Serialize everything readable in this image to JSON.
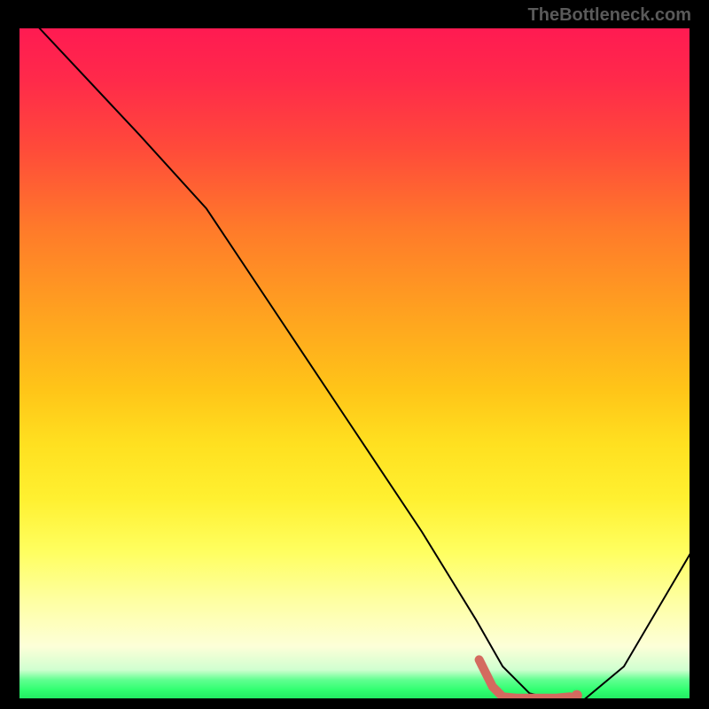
{
  "attribution": "TheBottleneck.com",
  "chart_data": {
    "type": "line",
    "title": "",
    "xlabel": "",
    "ylabel": "",
    "xlim": [
      0,
      100
    ],
    "ylim": [
      0,
      100
    ],
    "series": [
      {
        "name": "bottleneck-curve",
        "x": [
          3,
          18,
          28,
          40,
          50,
          60,
          68,
          72,
          76,
          80,
          84,
          90,
          100
        ],
        "values": [
          100,
          84,
          73,
          55,
          40,
          25,
          12,
          5,
          1,
          0,
          0,
          5,
          22
        ],
        "color": "#000000",
        "width": 2
      }
    ],
    "highlight_band": {
      "name": "optimal-range",
      "x": [
        68.5,
        70.5,
        72,
        74,
        76,
        78,
        80,
        82
      ],
      "values": [
        6,
        2,
        0.5,
        0.3,
        0.3,
        0.3,
        0.3,
        0.5
      ],
      "color": "#d46a5f",
      "width": 10
    },
    "highlight_dot": {
      "x": 83,
      "value": 0.7,
      "color": "#d46a5f",
      "radius": 6
    },
    "background_gradient": {
      "top": "#ff1a52",
      "mid": "#ffe020",
      "bottom": "#20e860"
    }
  }
}
